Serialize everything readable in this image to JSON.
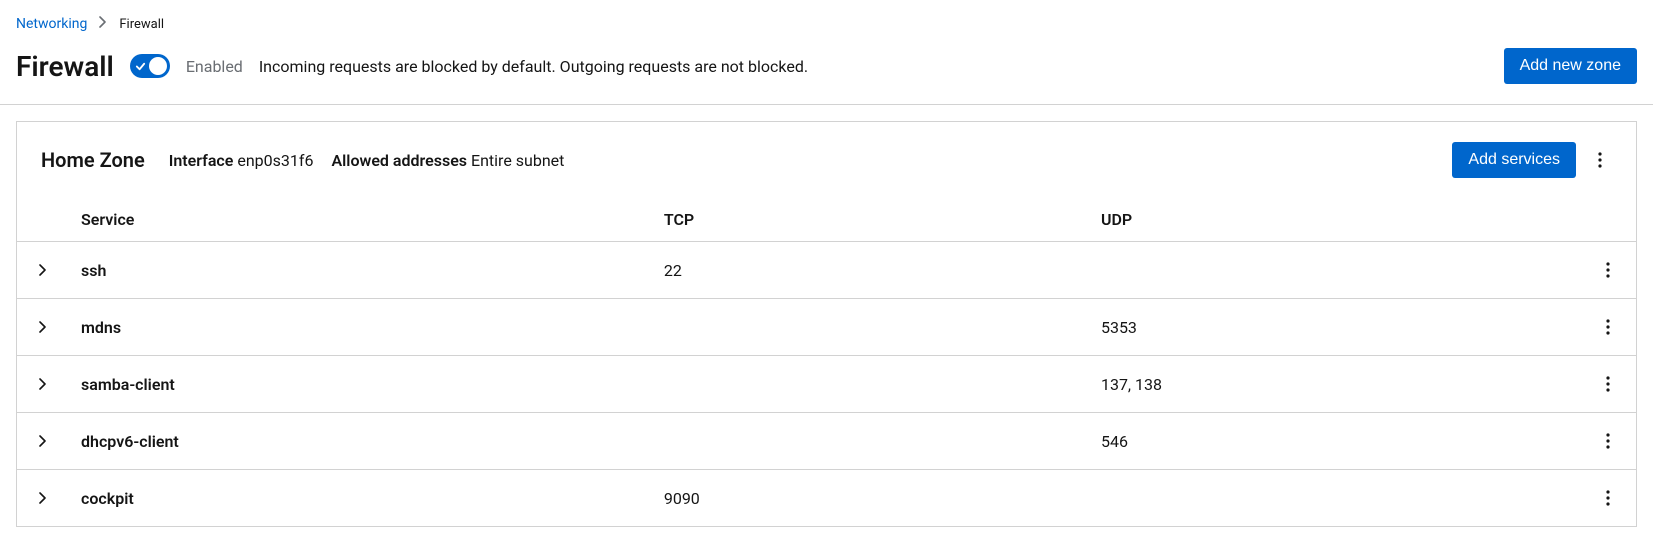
{
  "breadcrumb": {
    "parent": "Networking",
    "current": "Firewall"
  },
  "header": {
    "title": "Firewall",
    "status_label": "Enabled",
    "description": "Incoming requests are blocked by default. Outgoing requests are not blocked.",
    "add_zone_label": "Add new zone"
  },
  "zone": {
    "title": "Home Zone",
    "interface_key": "Interface",
    "interface_value": "enp0s31f6",
    "allowed_key": "Allowed addresses",
    "allowed_value": "Entire subnet",
    "add_services_label": "Add services"
  },
  "table": {
    "headers": {
      "service": "Service",
      "tcp": "TCP",
      "udp": "UDP"
    },
    "rows": [
      {
        "service": "ssh",
        "tcp": "22",
        "udp": ""
      },
      {
        "service": "mdns",
        "tcp": "",
        "udp": "5353"
      },
      {
        "service": "samba-client",
        "tcp": "",
        "udp": "137, 138"
      },
      {
        "service": "dhcpv6-client",
        "tcp": "",
        "udp": "546"
      },
      {
        "service": "cockpit",
        "tcp": "9090",
        "udp": ""
      }
    ]
  }
}
